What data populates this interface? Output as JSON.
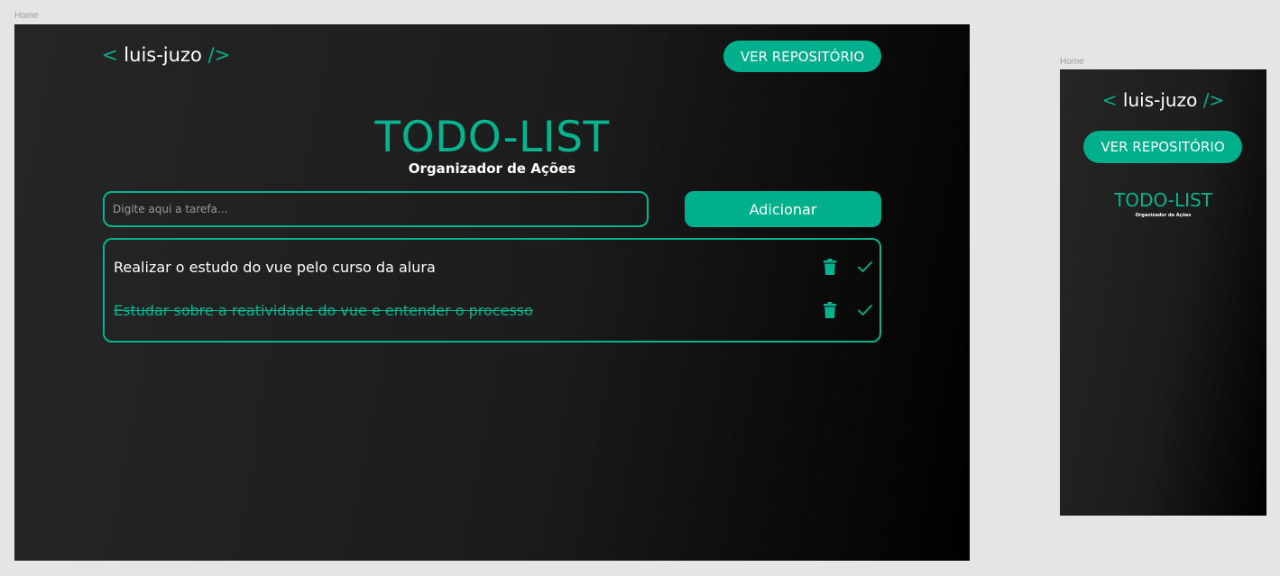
{
  "frames": {
    "desktop_label": "Home",
    "mobile_label": "Home"
  },
  "header": {
    "logo_open": "<",
    "logo_name": "luis-juzo",
    "logo_close": "/>",
    "repo_button": "VER REPOSITÓRIO"
  },
  "hero": {
    "title": "TODO-LIST",
    "subtitle": "Organizador de Ações"
  },
  "form": {
    "input_placeholder": "Digite aqui a tarefa...",
    "input_value": "",
    "add_button": "Adicionar"
  },
  "tasks": [
    {
      "text": "Realizar o estudo do vue pelo curso da alura",
      "completed": false
    },
    {
      "text": "Estudar sobre a reatividade do vue e entender o processo",
      "completed": true
    }
  ],
  "icons": {
    "delete": "trash-icon",
    "complete": "check-icon"
  },
  "colors": {
    "accent": "#00b08d",
    "background_start": "#262626",
    "background_end": "#000000",
    "canvas": "#e5e5e5"
  }
}
